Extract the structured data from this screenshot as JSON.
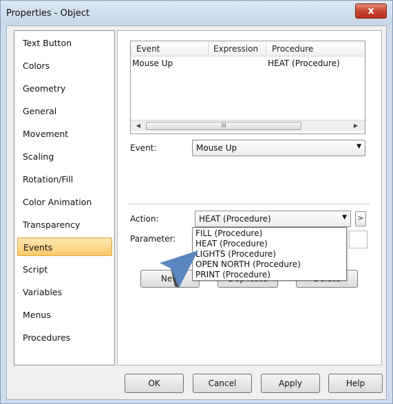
{
  "window": {
    "title": "Properties - Object",
    "close_glyph": "x"
  },
  "sidebar": {
    "items": [
      {
        "label": "Text Button"
      },
      {
        "label": "Colors"
      },
      {
        "label": "Geometry"
      },
      {
        "label": "General"
      },
      {
        "label": "Movement"
      },
      {
        "label": "Scaling"
      },
      {
        "label": "Rotation/Fill"
      },
      {
        "label": "Color Animation"
      },
      {
        "label": "Transparency"
      },
      {
        "label": "Events",
        "selected": true
      },
      {
        "label": "Script"
      },
      {
        "label": "Variables"
      },
      {
        "label": "Menus"
      },
      {
        "label": "Procedures"
      }
    ]
  },
  "events_table": {
    "columns": [
      "Event",
      "Expression",
      "Procedure"
    ],
    "rows": [
      {
        "event": "Mouse Up",
        "expression": "",
        "procedure": "HEAT (Procedure)"
      }
    ],
    "scroll_thumb_glyph": "III"
  },
  "event_field": {
    "label": "Event:",
    "value": "Mouse Up"
  },
  "action_field": {
    "label": "Action:",
    "value": "HEAT (Procedure)",
    "more_glyph": ">"
  },
  "parameter_field": {
    "label": "Parameter:"
  },
  "action_dropdown": {
    "options": [
      "FILL (Procedure)",
      "HEAT (Procedure)",
      "LIGHTS (Procedure)",
      "OPEN NORTH (Procedure)",
      "PRINT (Procedure)"
    ]
  },
  "row_buttons": {
    "new_label": "New",
    "duplicate_label": "Duplicate",
    "delete_label": "Delete"
  },
  "footer": {
    "ok_label": "OK",
    "cancel_label": "Cancel",
    "apply_label": "Apply",
    "help_label": "Help"
  },
  "colors": {
    "selected_item": "#f9c96b",
    "title_bar": "#cfdceb",
    "close_button": "#c5412b",
    "pointer": "#5b86c0"
  }
}
